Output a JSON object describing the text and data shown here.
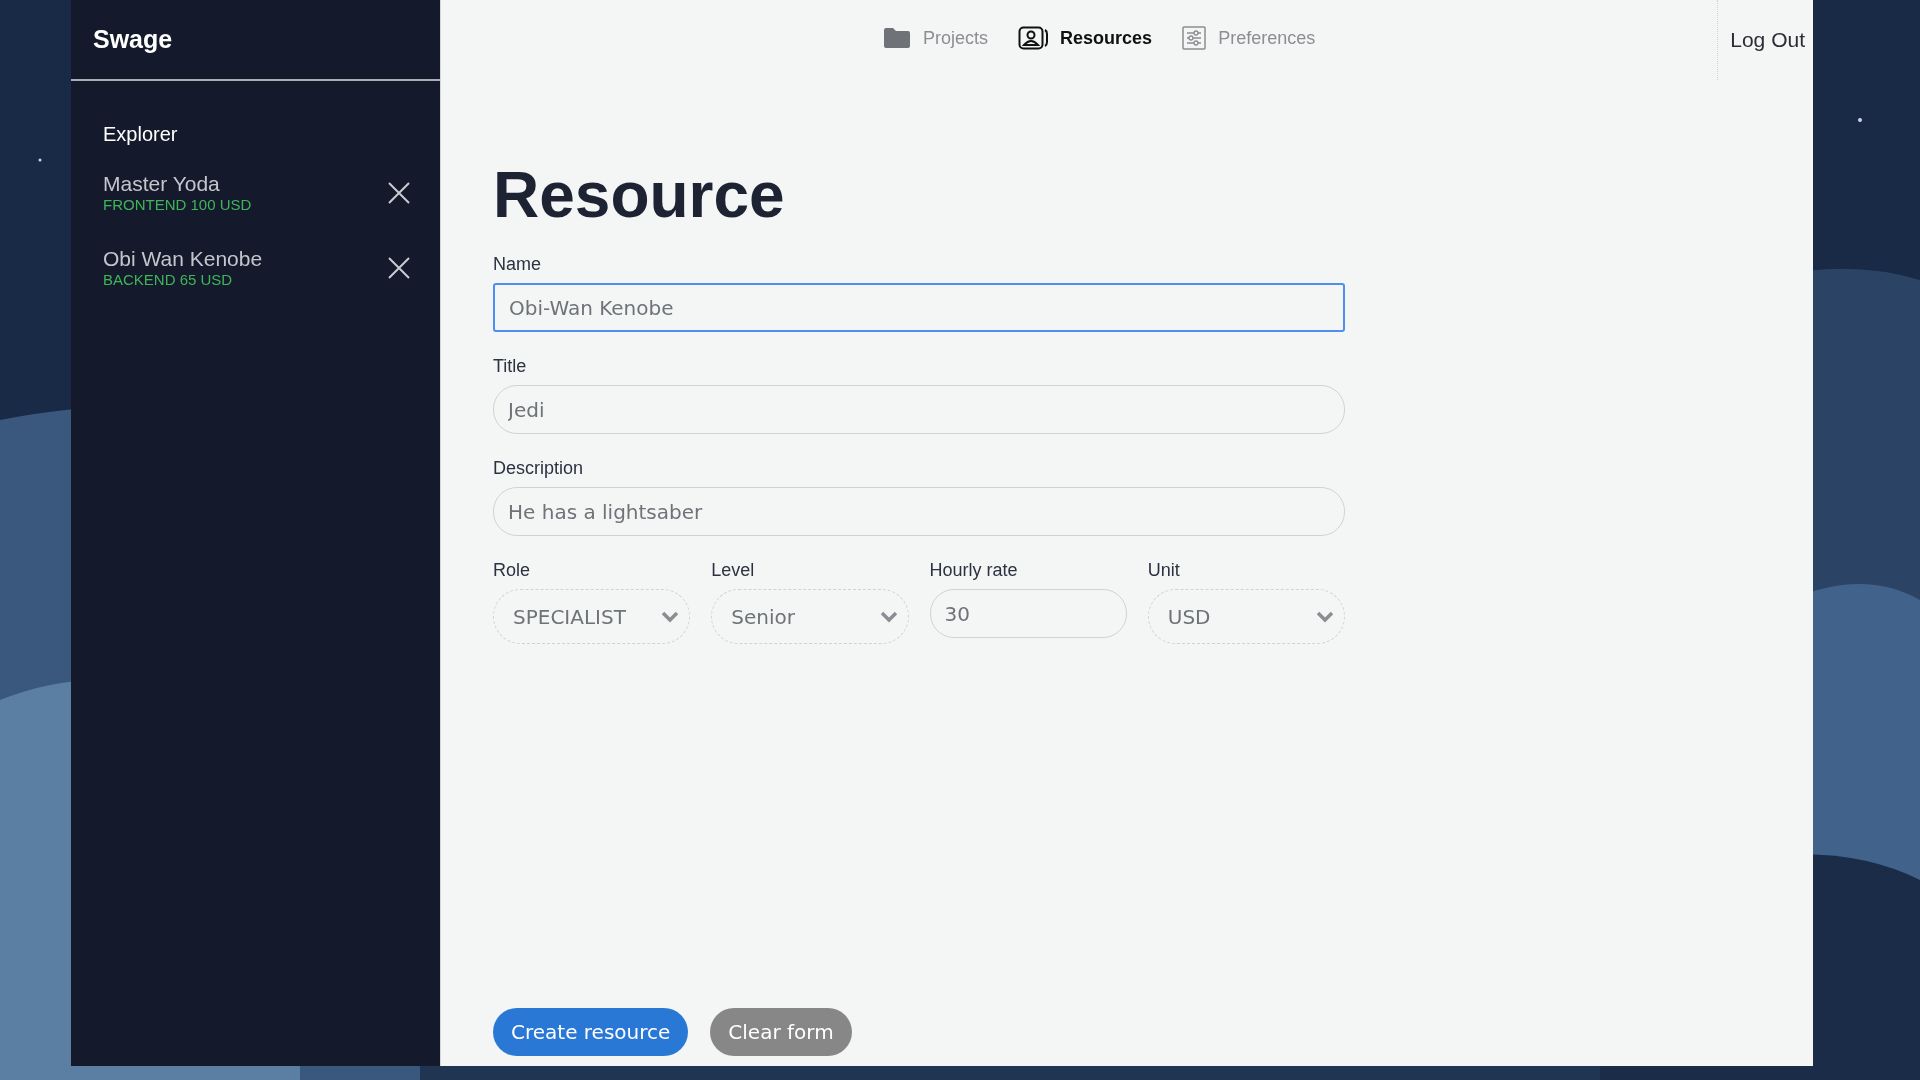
{
  "app": {
    "name": "Swage"
  },
  "sidebar": {
    "heading": "Explorer",
    "items": [
      {
        "name": "Master Yoda",
        "details": "FRONTEND 100 USD"
      },
      {
        "name": "Obi Wan Kenobe",
        "details": "BACKEND 65 USD"
      }
    ]
  },
  "nav": {
    "tabs": [
      {
        "kind": "folder",
        "label": "Projects",
        "selected": false
      },
      {
        "kind": "person",
        "label": "Resources",
        "selected": true
      },
      {
        "kind": "sliders",
        "label": "Preferences",
        "selected": false
      }
    ],
    "logout": "Log Out"
  },
  "form": {
    "title": "Resource",
    "fields": [
      {
        "kind": "text",
        "label": "Name",
        "value": "Obi-Wan Kenobe",
        "focused": true
      },
      {
        "kind": "text",
        "label": "Title",
        "value": "Jedi",
        "focused": false
      },
      {
        "kind": "text",
        "label": "Description",
        "value": "He has a lightsaber",
        "focused": false
      }
    ],
    "row": [
      {
        "kind": "select",
        "label": "Role",
        "value": "SPECIALIST",
        "focused": false
      },
      {
        "kind": "select",
        "label": "Level",
        "value": "Senior",
        "focused": false
      },
      {
        "kind": "text",
        "label": "Hourly rate",
        "value": "30",
        "focused": false
      },
      {
        "kind": "select",
        "label": "Unit",
        "value": "USD",
        "focused": false
      }
    ]
  },
  "buttons": [
    {
      "kind": "primary",
      "label": "Create resource"
    },
    {
      "kind": "secondary",
      "label": "Clear form"
    }
  ]
}
